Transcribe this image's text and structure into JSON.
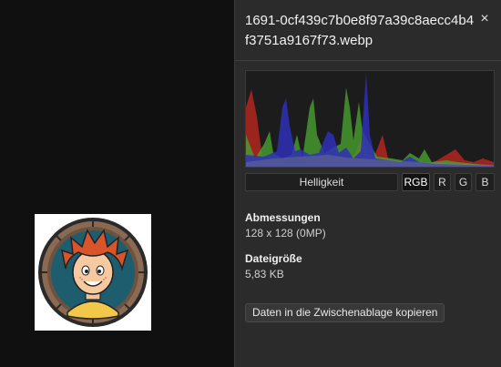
{
  "info_panel": {
    "filename": "1691-0cf439c7b0e8f97a39c8aecc4b4f3751a9167f73.webp",
    "close_label": "×",
    "histogram": {
      "modes": [
        "Helligkeit",
        "RGB",
        "R",
        "G",
        "B"
      ],
      "selected_mode": "RGB",
      "channel_colors": {
        "red": "#b3261e",
        "green": "#49a030",
        "blue": "#2f2fb8"
      }
    },
    "dimensions": {
      "label": "Abmessungen",
      "value": "128 x 128 (0MP)"
    },
    "filesize": {
      "label": "Dateigröße",
      "value": "5,83 KB"
    },
    "copy_button": "Daten in die Zwischenablage kopieren"
  },
  "viewer": {
    "image_alt": "cartoon avatar with red spiky hair in a wooden ring frame"
  }
}
